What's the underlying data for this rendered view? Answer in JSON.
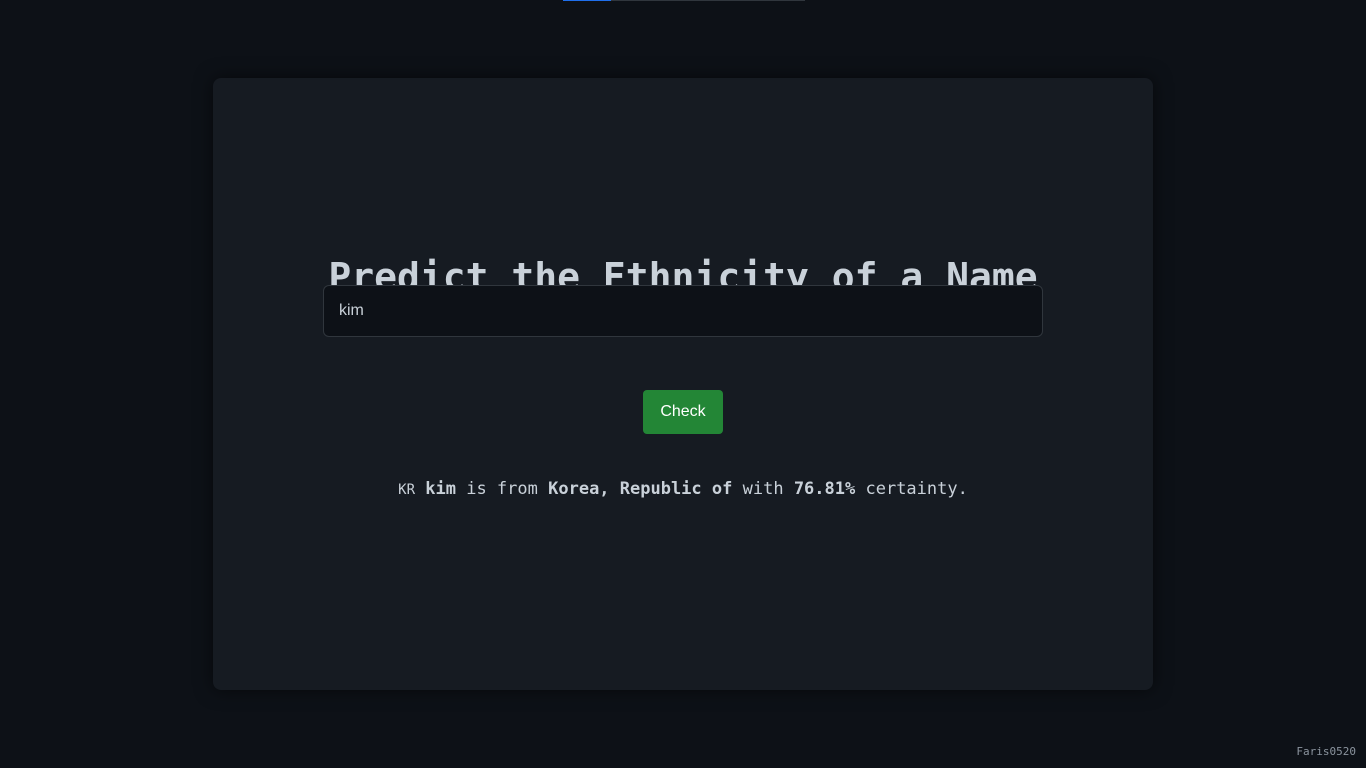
{
  "top_progress": {
    "fraction": 0.2,
    "track_color": "#30363d",
    "fill_color": "#1f6feb"
  },
  "card": {
    "title": "Predict the Ethnicity of a Name",
    "input": {
      "value": "kim",
      "placeholder": ""
    },
    "check_button_label": "Check",
    "result": {
      "flag_code": "KR",
      "name": "kim",
      "text_is_from": "is from",
      "country": "Korea, Republic of",
      "text_with": "with",
      "certainty": "76.81%",
      "text_certainty": "certainty."
    }
  },
  "footer": {
    "author": "Faris0520"
  },
  "colors": {
    "page_background": "#0d1117",
    "card_background": "#161b22",
    "button_green": "#238636",
    "text": "#c9d1d9"
  }
}
